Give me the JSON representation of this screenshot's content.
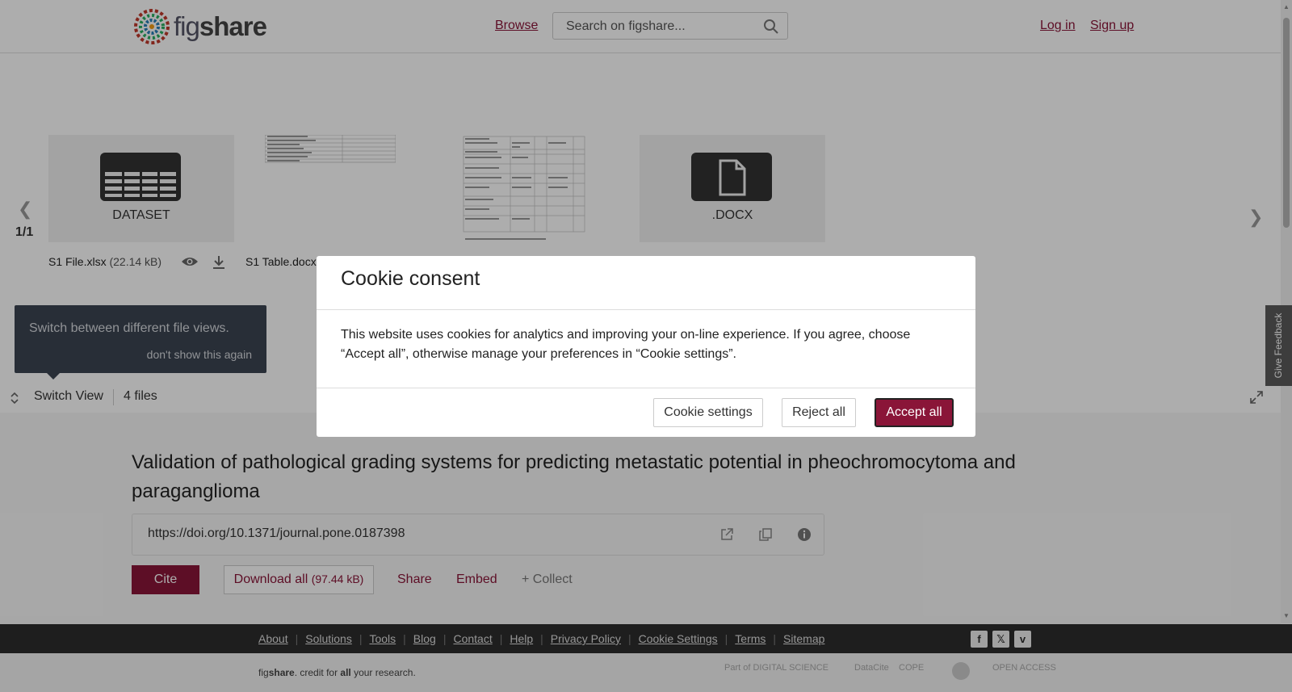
{
  "header": {
    "logo_text_fig": "fig",
    "logo_text_share": "share",
    "browse": "Browse",
    "search_placeholder": "Search on figshare...",
    "login": "Log in",
    "signup": "Sign up"
  },
  "carousel": {
    "pager": "1/1",
    "files": [
      {
        "name": "S1 File.xlsx",
        "size": "(22.14 kB)",
        "thumb_label": "DATASET"
      },
      {
        "name": "S1 Table.docx",
        "size": "",
        "thumb_label": ""
      },
      {
        "name": "",
        "size": "",
        "thumb_label": ""
      },
      {
        "name": "",
        "size": "",
        "thumb_label": ".DOCX"
      }
    ]
  },
  "tooltip": {
    "text": "Switch between different file views.",
    "dismiss": "don't show this again"
  },
  "switchbar": {
    "label": "Switch View",
    "files_count": "4 files"
  },
  "article": {
    "title": "Validation of pathological grading systems for predicting metastatic potential in pheochromocytoma and paraganglioma",
    "doi": "https://doi.org/10.1371/journal.pone.0187398",
    "cite": "Cite",
    "download_all": "Download all",
    "download_size": "(97.44 kB)",
    "share": "Share",
    "embed": "Embed",
    "collect": "+ Collect"
  },
  "footer": {
    "links": [
      "About",
      "Solutions",
      "Tools",
      "Blog",
      "Contact",
      "Help",
      "Privacy Policy",
      "Cookie Settings",
      "Terms",
      "Sitemap"
    ],
    "tagline_fig": "fig",
    "tagline_share": "share",
    "tagline_mid": ". credit for ",
    "tagline_all": "all",
    "tagline_end": " your research.",
    "partners": [
      "Part of DIGITAL SCIENCE",
      "DataCite",
      "COPE",
      "",
      "OPEN ACCESS"
    ]
  },
  "feedback": "Give Feedback",
  "cookie": {
    "title": "Cookie consent",
    "body": "This website uses cookies for analytics and improving your on-line experience. If you agree, choose “Accept all”, otherwise manage your preferences in “Cookie settings”.",
    "settings": "Cookie settings",
    "reject": "Reject all",
    "accept": "Accept all"
  },
  "colors": {
    "brand": "#8a1538",
    "footer_dark": "#2d2d2d",
    "tooltip_bg": "#3b4452"
  }
}
